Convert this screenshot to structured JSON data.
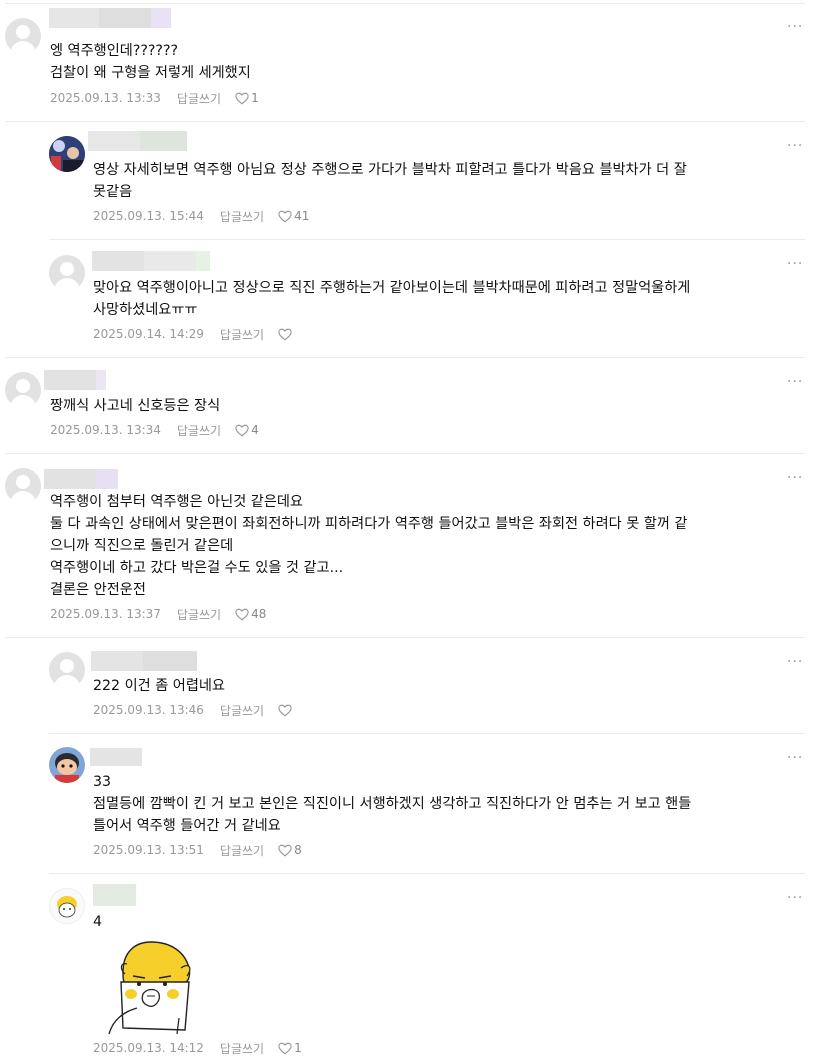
{
  "more_glyph": "···",
  "comments": [
    {
      "id": "c1",
      "lines": [
        "엥 역주행인데??????",
        "검찰이 왜 구형을 저렇게 세게했지"
      ],
      "date": "2025.09.13. 13:33",
      "reply_label": "답글쓰기",
      "likes": "1"
    },
    {
      "id": "c2",
      "lines": [
        "영상 자세히보면 역주행 아님요 정상 주행으로 가다가 블박차 피할려고 틀다가 박음요 블박차가 더 잘",
        "못같음"
      ],
      "date": "2025.09.13. 15:44",
      "reply_label": "답글쓰기",
      "likes": "41"
    },
    {
      "id": "c3",
      "lines": [
        "맞아요 역주행이아니고 정상으로 직진 주행하는거 같아보이는데 블박차때문에 피하려고 정말억울하게",
        "사망하셨네요ㅠㅠ"
      ],
      "date": "2025.09.14. 14:29",
      "reply_label": "답글쓰기",
      "likes": ""
    },
    {
      "id": "c4",
      "lines": [
        "짱깨식 사고네 신호등은 장식"
      ],
      "date": "2025.09.13. 13:34",
      "reply_label": "답글쓰기",
      "likes": "4"
    },
    {
      "id": "c5",
      "lines": [
        "역주행이 첨부터 역주행은 아닌것 같은데요",
        "둘 다 과속인 상태에서 맞은편이 좌회전하니까 피하려다가 역주행 들어갔고 블박은 좌회전 하려다 못 할꺼 같",
        "으니까 직진으로 돌린거 같은데",
        "역주행이네 하고 갔다 박은걸 수도 있을 것 같고...",
        "결론은 안전운전"
      ],
      "date": "2025.09.13. 13:37",
      "reply_label": "답글쓰기",
      "likes": "48"
    },
    {
      "id": "c6",
      "lines": [
        "222 이건 좀 어렵네요"
      ],
      "date": "2025.09.13. 13:46",
      "reply_label": "답글쓰기",
      "likes": ""
    },
    {
      "id": "c7",
      "lines": [
        "33",
        "점멸등에 깜빡이 킨 거 보고 본인은 직진이니 서행하겠지 생각하고 직진하다가 안 멈추는 거 보고 핸들",
        "틀어서 역주행 들어간 거 같네요"
      ],
      "date": "2025.09.13. 13:51",
      "reply_label": "답글쓰기",
      "likes": "8"
    },
    {
      "id": "c8",
      "lines": [
        "4"
      ],
      "date": "2025.09.13. 14:12",
      "reply_label": "답글쓰기",
      "likes": "1"
    }
  ],
  "colors": {
    "text": "#111111",
    "meta": "#999999",
    "divider": "#ebebeb",
    "avatar_default": "#e2e2e2",
    "sticker_yellow": "#f7cf2a"
  },
  "icons": {
    "more": "more-options-icon",
    "like": "heart-icon",
    "avatar": "default-profile-icon"
  }
}
